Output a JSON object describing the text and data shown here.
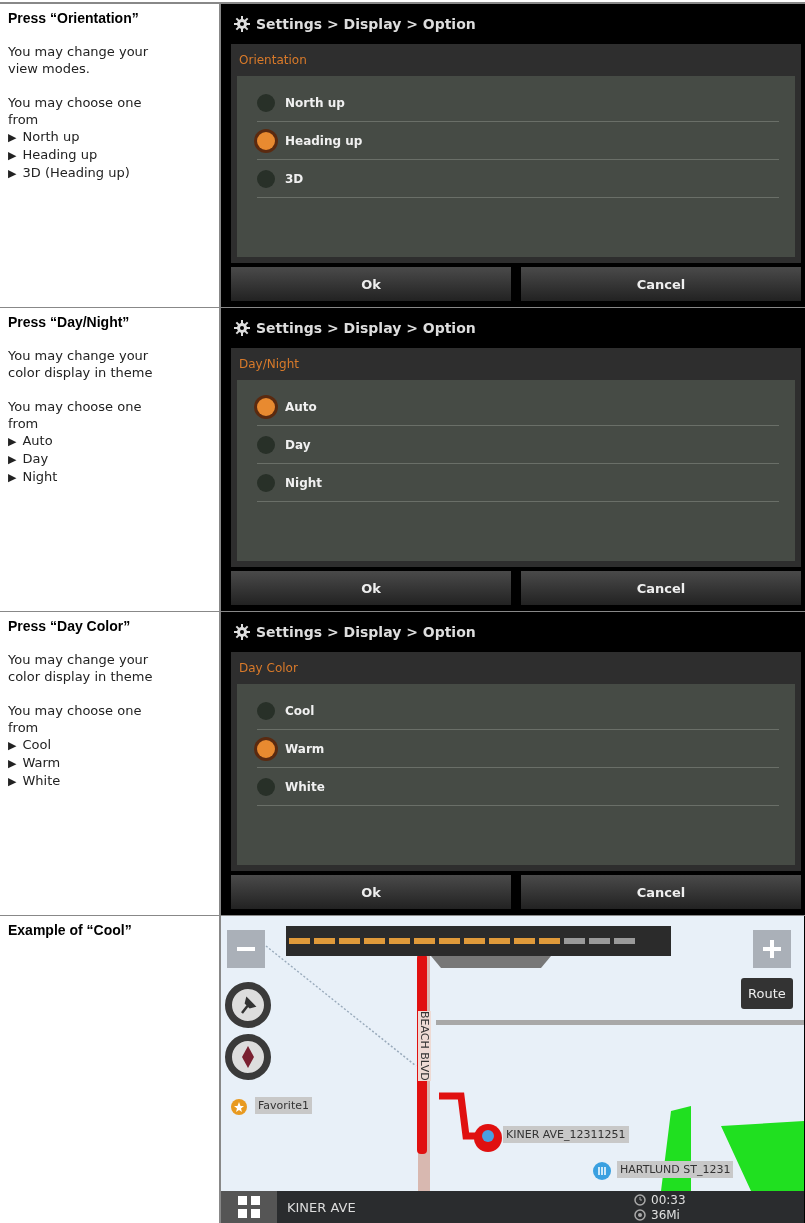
{
  "rows": [
    {
      "title": "Press “Orientation”",
      "paragraphs": [
        "You may change your view modes.",
        "You may choose one from"
      ],
      "marker": "▶",
      "bullets": [
        "North up",
        "Heading up",
        "3D (Heading up)"
      ],
      "screen": {
        "kind": "options",
        "breadcrumb": "Settings > Display > Option",
        "group_title": "Orientation",
        "options": [
          {
            "label": "North up",
            "selected": false
          },
          {
            "label": "Heading up",
            "selected": true
          },
          {
            "label": "3D",
            "selected": false
          }
        ],
        "buttons": [
          "Ok",
          "Cancel"
        ]
      }
    },
    {
      "title": "Press “Day/Night”",
      "paragraphs": [
        "You may change your color display in theme",
        "You may choose one from"
      ],
      "marker": "▶",
      "bullets": [
        "Auto",
        "Day",
        "Night"
      ],
      "screen": {
        "kind": "options",
        "breadcrumb": "Settings > Display > Option",
        "group_title": "Day/Night",
        "options": [
          {
            "label": "Auto",
            "selected": true
          },
          {
            "label": "Day",
            "selected": false
          },
          {
            "label": "Night",
            "selected": false
          }
        ],
        "buttons": [
          "Ok",
          "Cancel"
        ]
      }
    },
    {
      "title": "Press “Day Color”",
      "paragraphs": [
        "You may change your color display in theme",
        "You may choose one from"
      ],
      "marker": "▶",
      "bullets": [
        "Cool",
        "Warm",
        "White"
      ],
      "screen": {
        "kind": "options",
        "breadcrumb": "Settings > Display > Option",
        "group_title": "Day Color",
        "options": [
          {
            "label": "Cool",
            "selected": false
          },
          {
            "label": "Warm",
            "selected": true
          },
          {
            "label": "White",
            "selected": false
          }
        ],
        "buttons": [
          "Ok",
          "Cancel"
        ]
      }
    },
    {
      "title": "Example of “Cool”",
      "paragraphs": [],
      "bullets": [],
      "screen": {
        "kind": "map",
        "route_button": "Route",
        "road_label": "BEACH BLVD",
        "favorite": "Favorite1",
        "destination": "KINER AVE_12311251",
        "poi": "HARTLUND ST_1231",
        "street": "KINER AVE",
        "time": "00:33",
        "distance": "36Mi"
      }
    }
  ]
}
